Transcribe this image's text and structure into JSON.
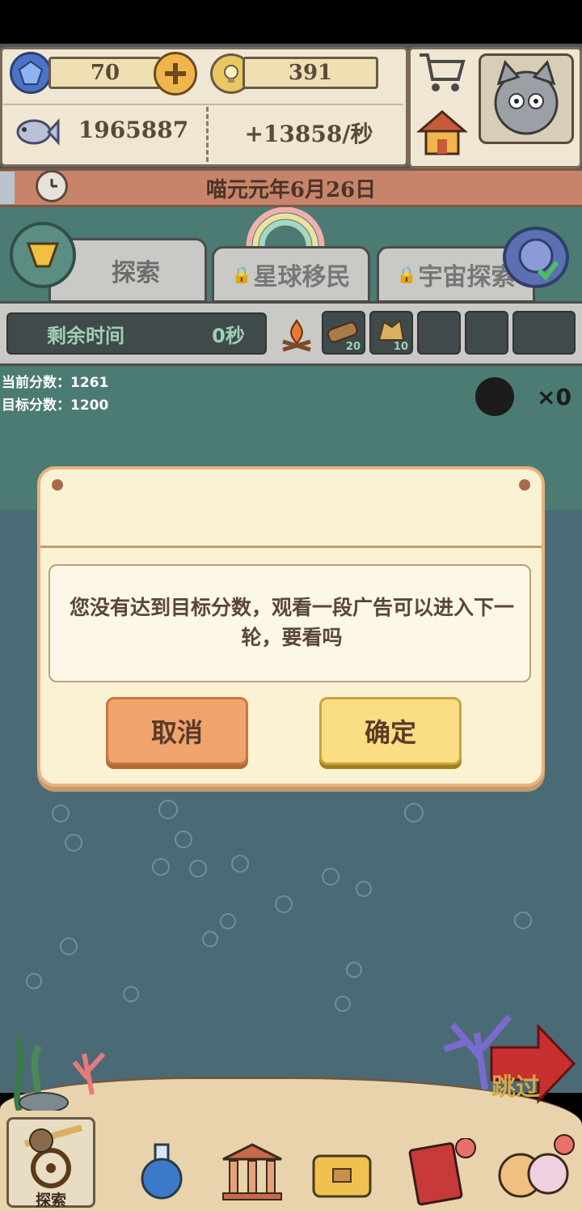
{
  "hud": {
    "gems": "70",
    "bulbs": "391",
    "fish_total": "1965887",
    "fish_rate": "+13858/秒"
  },
  "date": "喵元元年6月26日",
  "tabs": [
    {
      "label": "探索",
      "locked": false
    },
    {
      "label": "星球移民",
      "locked": true
    },
    {
      "label": "宇宙探索",
      "locked": true
    }
  ],
  "timer": {
    "label": "剩余时间",
    "value": "0秒"
  },
  "slots": [
    {
      "icon": "log-icon",
      "count": "20"
    },
    {
      "icon": "hay-icon",
      "count": "10"
    },
    {
      "icon": "",
      "count": ""
    },
    {
      "icon": "",
      "count": ""
    },
    {
      "icon": "",
      "count": ""
    }
  ],
  "scores": {
    "current": "当前分数：1261",
    "target": "目标分数：1200"
  },
  "bombs": "×0",
  "dialog": {
    "message": "您没有达到目标分数，观看一段广告可以进入下一轮，要看吗",
    "cancel_label": "取消",
    "ok_label": "确定"
  },
  "skip_label": "跳过",
  "bottom_nav": {
    "explore_label": "探索"
  },
  "colors": {
    "accent": "#efa46e",
    "confirm": "#fbde83",
    "water": "#4a6b75"
  }
}
